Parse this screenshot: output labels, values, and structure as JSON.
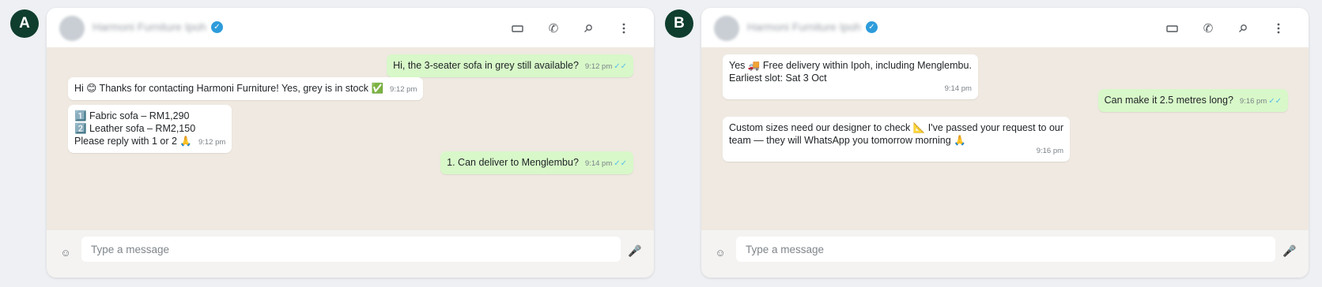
{
  "panels": [
    {
      "badge": "A",
      "contact_name": "Harmoni Furniture Ipoh",
      "verified_glyph": "✓",
      "header_icons": [
        "video-icon",
        "phone-icon",
        "search-icon",
        "menu-icon"
      ],
      "messages": [
        {
          "dir": "out",
          "text": "Hi, the 3-seater sofa in grey still available?",
          "time": "9:12 pm",
          "ticks": "✓✓"
        },
        {
          "dir": "in",
          "text": "Hi 😊 Thanks for contacting Harmoni Furniture! Yes, grey is in stock ✅",
          "time": "9:12 pm"
        },
        {
          "dir": "in",
          "text": "1️⃣ Fabric sofa – RM1,290\n2️⃣ Leather sofa – RM2,150\nPlease reply with 1 or 2 🙏",
          "time": "9:12 pm"
        },
        {
          "dir": "out",
          "text": "1. Can deliver to Menglembu?",
          "time": "9:14 pm",
          "ticks": "✓✓"
        }
      ],
      "input_placeholder": "Type a message"
    },
    {
      "badge": "B",
      "contact_name": "Harmoni Furniture Ipoh",
      "verified_glyph": "✓",
      "header_icons": [
        "video-icon",
        "phone-icon",
        "search-icon",
        "menu-icon"
      ],
      "messages": [
        {
          "dir": "in",
          "text": "Yes 🚚 Free delivery within Ipoh, including Menglembu.\nEarliest slot: Sat 3 Oct",
          "time": "9:14 pm"
        },
        {
          "dir": "out",
          "text": "Can make it 2.5 metres long?",
          "time": "9:16 pm",
          "ticks": "✓✓"
        },
        {
          "dir": "in",
          "text": "Custom sizes need our designer to check 📐 I've passed your request to our\nteam — they will WhatsApp you tomorrow morning 🙏",
          "time": "9:16 pm"
        }
      ],
      "input_placeholder": "Type a message"
    }
  ],
  "colors": {
    "badge_bg": "#0f3d2e",
    "outgoing_bubble": "#d8f8c9",
    "incoming_bubble": "#ffffff",
    "chat_bg": "#efe9e1",
    "read_ticks": "#53bdeb"
  }
}
